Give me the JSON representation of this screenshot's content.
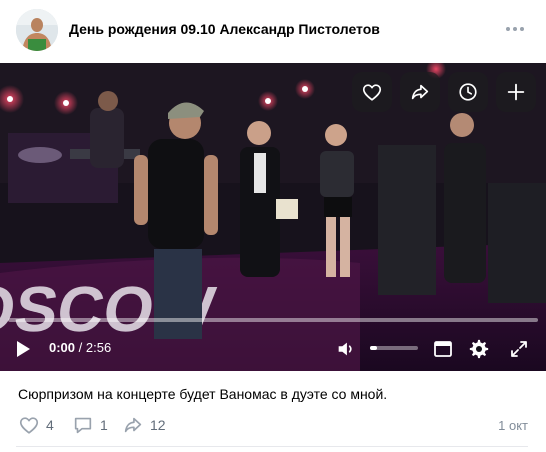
{
  "post": {
    "title": "День рождения 09.10 Александр Пистолетов",
    "caption": "Сюрпризом на концерте будет Ваномас в дуэте со мной.",
    "date": "1 окт"
  },
  "video": {
    "current_time": "0:00",
    "separator": " / ",
    "duration": "2:56",
    "progress": 0.0,
    "volume": 0.15,
    "stage_text": "OSCOW"
  },
  "overlay_actions": [
    "heart-icon",
    "share-icon",
    "clock-icon",
    "plus-icon"
  ],
  "counts": {
    "likes": "4",
    "comments": "1",
    "reposts": "12"
  },
  "colors": {
    "accent": "#2688eb",
    "icon_gray": "#99a2ad",
    "text_secondary": "#818c99"
  }
}
